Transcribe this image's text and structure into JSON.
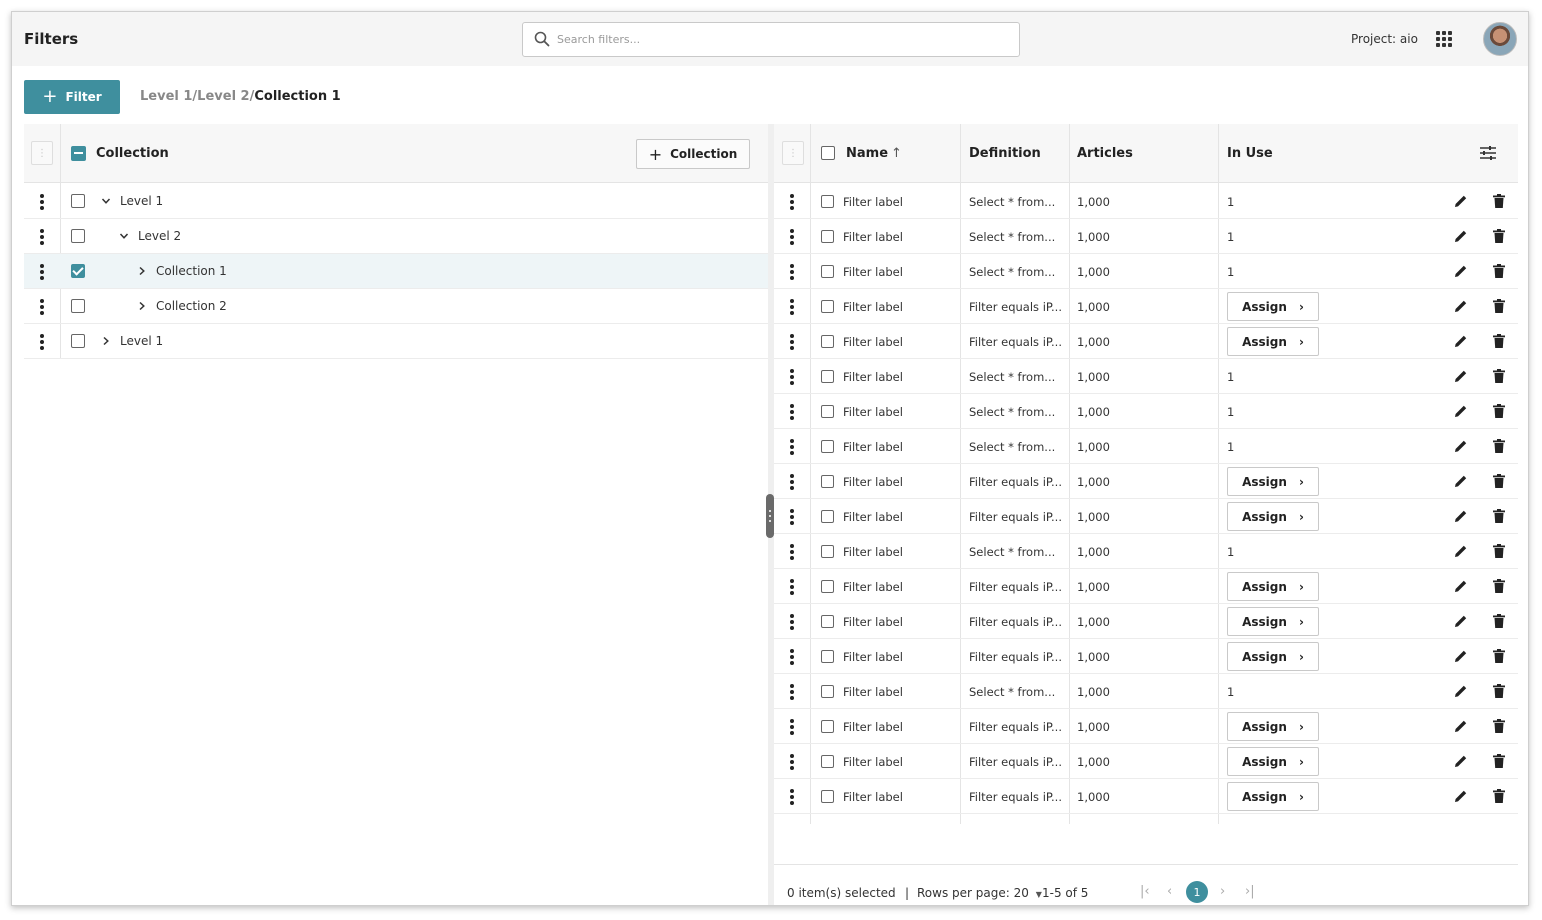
{
  "header": {
    "title": "Filters",
    "search_placeholder": "Search filters...",
    "project_label": "Project: aio"
  },
  "toolbar": {
    "filter_button": "Filter",
    "breadcrumb": {
      "part1": "Level 1/",
      "part2": "Level 2/",
      "current": "Collection 1"
    }
  },
  "tree": {
    "header_label": "Collection",
    "add_button": "Collection",
    "rows": [
      {
        "label": "Level 1",
        "depth": 0,
        "expanded": true,
        "checked": false
      },
      {
        "label": "Level 2",
        "depth": 1,
        "expanded": true,
        "checked": false
      },
      {
        "label": "Collection 1",
        "depth": 2,
        "expanded": false,
        "checked": true,
        "selected": true
      },
      {
        "label": "Collection 2",
        "depth": 2,
        "expanded": false,
        "checked": false
      },
      {
        "label": "Level 1",
        "depth": 0,
        "expanded": false,
        "checked": false
      }
    ]
  },
  "table": {
    "columns": {
      "name": "Name",
      "definition": "Definition",
      "articles": "Articles",
      "in_use": "In Use"
    },
    "assign_label": "Assign",
    "rows": [
      {
        "name": "Filter label",
        "definition": "Select * from...",
        "articles": "1,000",
        "in_use": "1"
      },
      {
        "name": "Filter label",
        "definition": "Select * from...",
        "articles": "1,000",
        "in_use": "1"
      },
      {
        "name": "Filter label",
        "definition": "Select * from...",
        "articles": "1,000",
        "in_use": "1"
      },
      {
        "name": "Filter label",
        "definition": "Filter equals iP...",
        "articles": "1,000",
        "in_use": null
      },
      {
        "name": "Filter label",
        "definition": "Filter equals iP...",
        "articles": "1,000",
        "in_use": null
      },
      {
        "name": "Filter label",
        "definition": "Select * from...",
        "articles": "1,000",
        "in_use": "1"
      },
      {
        "name": "Filter label",
        "definition": "Select * from...",
        "articles": "1,000",
        "in_use": "1"
      },
      {
        "name": "Filter label",
        "definition": "Select * from...",
        "articles": "1,000",
        "in_use": "1"
      },
      {
        "name": "Filter label",
        "definition": "Filter equals iP...",
        "articles": "1,000",
        "in_use": null
      },
      {
        "name": "Filter label",
        "definition": "Filter equals iP...",
        "articles": "1,000",
        "in_use": null
      },
      {
        "name": "Filter label",
        "definition": "Select * from...",
        "articles": "1,000",
        "in_use": "1"
      },
      {
        "name": "Filter label",
        "definition": "Filter equals iP...",
        "articles": "1,000",
        "in_use": null
      },
      {
        "name": "Filter label",
        "definition": "Filter equals iP...",
        "articles": "1,000",
        "in_use": null
      },
      {
        "name": "Filter label",
        "definition": "Filter equals iP...",
        "articles": "1,000",
        "in_use": null
      },
      {
        "name": "Filter label",
        "definition": "Select * from...",
        "articles": "1,000",
        "in_use": "1"
      },
      {
        "name": "Filter label",
        "definition": "Filter equals iP...",
        "articles": "1,000",
        "in_use": null
      },
      {
        "name": "Filter label",
        "definition": "Filter equals iP...",
        "articles": "1,000",
        "in_use": null
      },
      {
        "name": "Filter label",
        "definition": "Filter equals iP...",
        "articles": "1,000",
        "in_use": null
      }
    ]
  },
  "footer": {
    "selected": "0 item(s) selected",
    "separator": "|",
    "rows_per_page": "Rows per page: 20",
    "range": "1-5 of 5",
    "current_page": "1"
  },
  "colors": {
    "accent": "#3f8f9e"
  }
}
